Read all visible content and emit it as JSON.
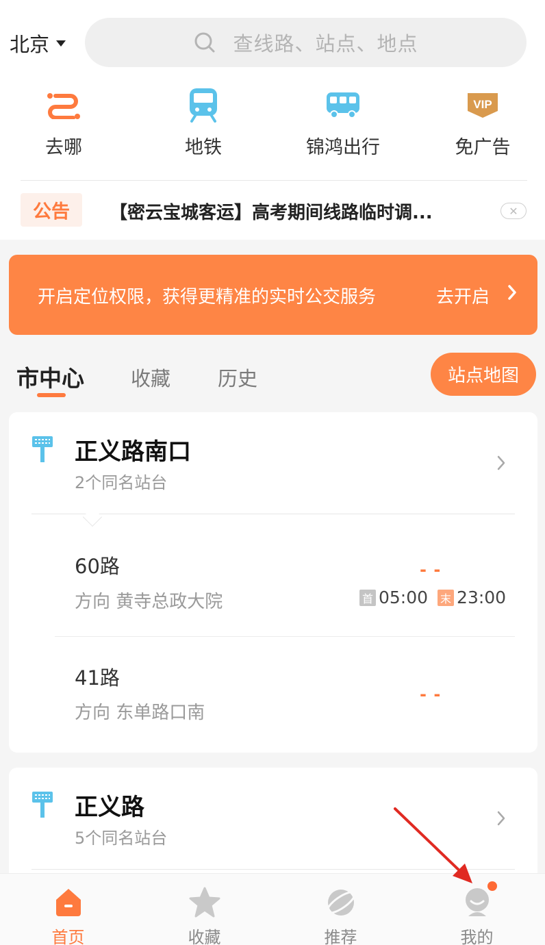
{
  "header": {
    "city": "北京",
    "search_placeholder": "查线路、站点、地点"
  },
  "quick_actions": [
    {
      "label": "去哪",
      "icon": "route-icon"
    },
    {
      "label": "地铁",
      "icon": "subway-icon"
    },
    {
      "label": "锦鸿出行",
      "icon": "bus-icon"
    },
    {
      "label": "免广告",
      "icon": "vip-icon"
    }
  ],
  "notice": {
    "tag": "公告",
    "text": "【密云宝城客运】高考期间线路临时调..."
  },
  "banner": {
    "message": "开启定位权限，获得更精准的实时公交服务",
    "cta": "去开启"
  },
  "tabs": [
    {
      "label": "市中心",
      "active": true
    },
    {
      "label": "收藏",
      "active": false
    },
    {
      "label": "历史",
      "active": false
    }
  ],
  "map_button": "站点地图",
  "stations": [
    {
      "name": "正义路南口",
      "sub": "2个同名站台",
      "routes": [
        {
          "name": "60路",
          "direction": "方向 黄寺总政大院",
          "realtime": "- -",
          "first_tag": "首",
          "first_time": "05:00",
          "last_tag": "末",
          "last_time": "23:00"
        },
        {
          "name": "41路",
          "direction": "方向 东单路口南",
          "realtime": "- -"
        }
      ]
    },
    {
      "name": "正义路",
      "sub": "5个同名站台"
    }
  ],
  "bottom_nav": [
    {
      "label": "首页",
      "icon": "home-icon",
      "active": true
    },
    {
      "label": "收藏",
      "icon": "star-icon",
      "active": false
    },
    {
      "label": "推荐",
      "icon": "planet-icon",
      "active": false
    },
    {
      "label": "我的",
      "icon": "profile-icon",
      "active": false
    }
  ],
  "colors": {
    "accent": "#fe7a3e",
    "banner": "#fe8545",
    "station_icon": "#5bc2ea",
    "annotation_arrow": "#e02a22"
  }
}
